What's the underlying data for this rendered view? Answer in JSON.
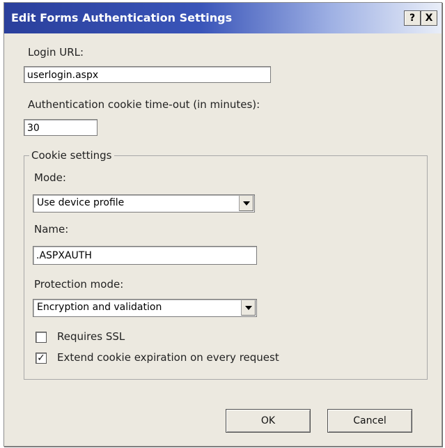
{
  "dialog": {
    "title": "Edit Forms Authentication Settings",
    "help_button": "?",
    "close_button": "X"
  },
  "login_url": {
    "label": "Login URL:",
    "value": "userlogin.aspx"
  },
  "timeout": {
    "label": "Authentication cookie time-out (in minutes):",
    "value": "30"
  },
  "cookie_settings": {
    "legend": "Cookie settings",
    "mode": {
      "label": "Mode:",
      "selected": "Use device profile"
    },
    "name": {
      "label": "Name:",
      "value": ".ASPXAUTH"
    },
    "protection": {
      "label": "Protection mode:",
      "selected": "Encryption and validation"
    },
    "requires_ssl": {
      "label": "Requires SSL",
      "checked": false
    },
    "extend_expiration": {
      "label": "Extend cookie expiration on every request",
      "checked": true
    }
  },
  "buttons": {
    "ok": "OK",
    "cancel": "Cancel"
  }
}
